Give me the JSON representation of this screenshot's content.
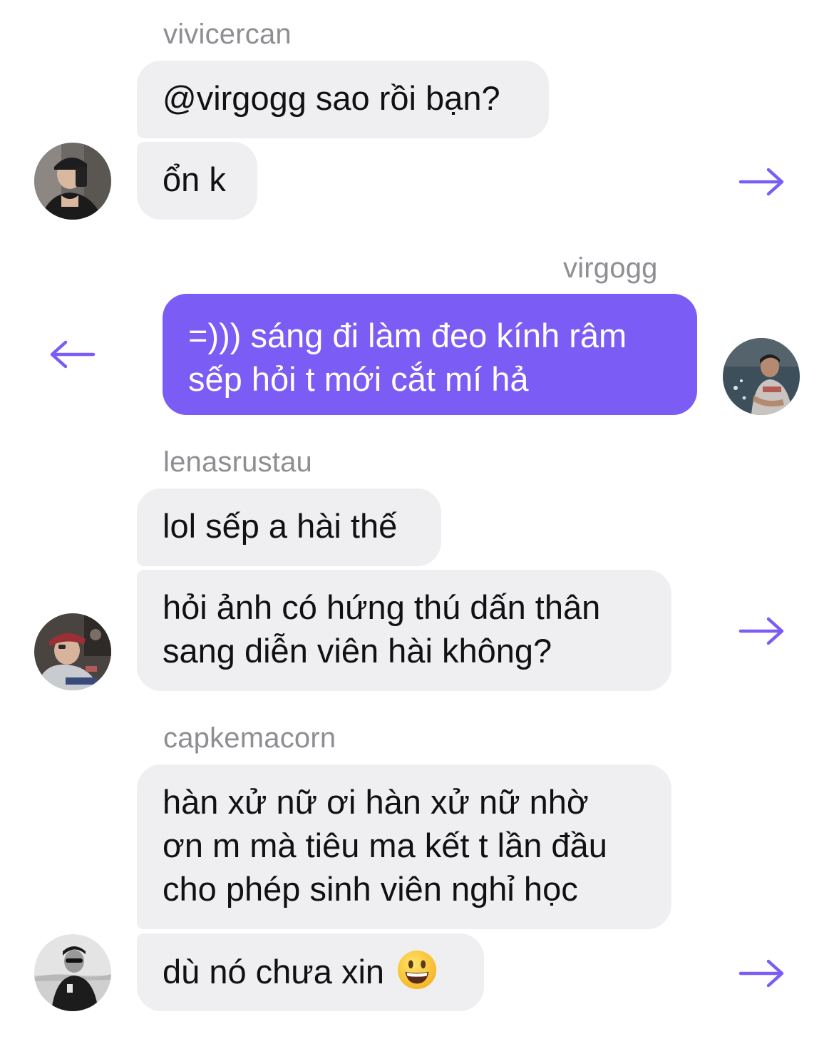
{
  "accent_color": "#7b5cf4",
  "bubble_in_color": "#efeff1",
  "messages": [
    {
      "sender": "vivicercan",
      "lines": [
        "@virgogg sao rồi bạn?",
        "ổn k"
      ],
      "action_icon": "arrow-right-icon"
    },
    {
      "sender": "virgogg",
      "lines": [
        "=))) sáng đi làm đeo kính râm\nsếp hỏi t mới cắt mí hả"
      ],
      "action_icon": "arrow-left-icon"
    },
    {
      "sender": "lenasrustau",
      "lines": [
        "lol sếp a hài thế",
        "hỏi ảnh có hứng thú dấn thân\nsang diễn viên hài không?"
      ],
      "action_icon": "arrow-right-icon"
    },
    {
      "sender": "capkemacorn",
      "lines": [
        "hàn xử nữ ơi hàn xử nữ nhờ\nơn m mà tiêu ma kết t lần đầu\ncho phép sinh viên nghỉ học",
        "dù nó chưa xin"
      ],
      "emoji": "grinning-face-emoji",
      "action_icon": "arrow-right-icon"
    }
  ]
}
